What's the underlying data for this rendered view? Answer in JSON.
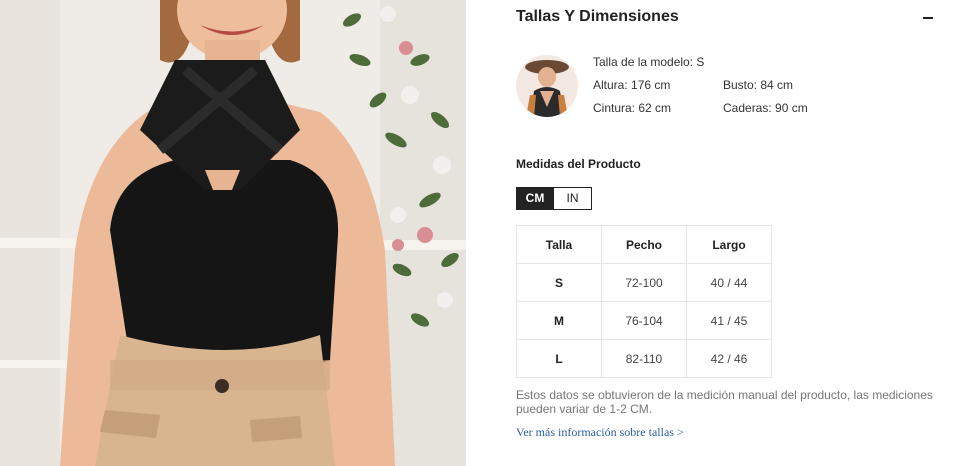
{
  "section": {
    "title": "Tallas Y Dimensiones"
  },
  "model": {
    "size_label": "Talla de la modelo: S",
    "height": "Altura: 176 cm",
    "bust": "Busto: 84 cm",
    "waist": "Cintura: 62 cm",
    "hips": "Caderas: 90 cm"
  },
  "measurements": {
    "title": "Medidas del Producto",
    "units": [
      "CM",
      "IN"
    ],
    "active_unit": "CM",
    "headers": [
      "Talla",
      "Pecho",
      "Largo"
    ],
    "rows": [
      [
        "S",
        "72-100",
        "40 / 44"
      ],
      [
        "M",
        "76-104",
        "41 / 45"
      ],
      [
        "L",
        "82-110",
        "42 / 46"
      ]
    ]
  },
  "note": "Estos datos se obtuvieron de la medición manual del producto, las mediciones pueden variar de 1-2 CM.",
  "more_link": "Ver más información sobre tallas >",
  "colors": {
    "accent_dark": "#222222",
    "link": "#2b5f9e",
    "note_text": "#767676",
    "table_border": "#e5e5e5"
  },
  "icons": {
    "collapse": "minus-icon"
  }
}
